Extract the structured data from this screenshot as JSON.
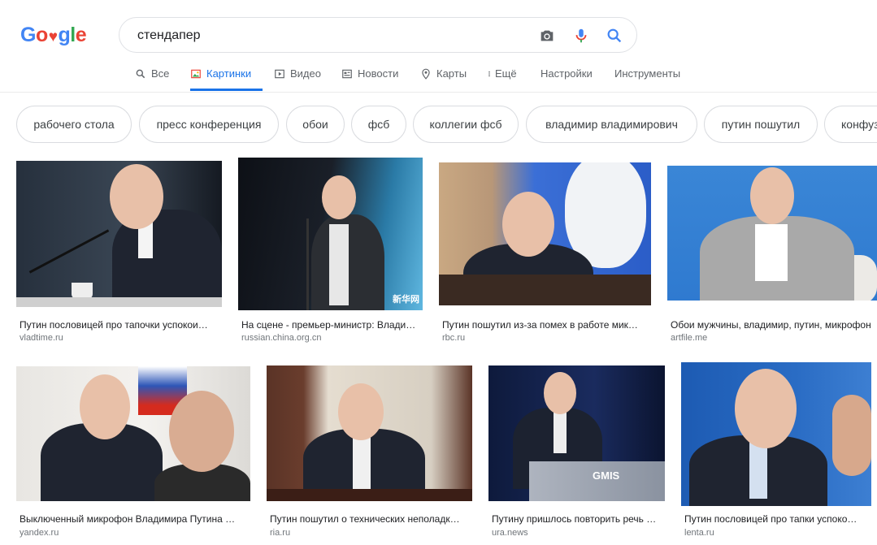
{
  "logo": {
    "letters": [
      "G",
      "o",
      "o",
      "g",
      "l",
      "e"
    ],
    "colors": [
      "#4285f4",
      "#ea4335",
      "#fbbc05",
      "#4285f4",
      "#34a853",
      "#ea4335"
    ]
  },
  "search": {
    "query": "стендапер",
    "icons": [
      "camera-icon",
      "microphone-icon",
      "search-icon"
    ]
  },
  "tabs": [
    {
      "label": "Все",
      "icon": "search-icon"
    },
    {
      "label": "Картинки",
      "icon": "image-icon",
      "active": true
    },
    {
      "label": "Видео",
      "icon": "video-icon"
    },
    {
      "label": "Новости",
      "icon": "news-icon"
    },
    {
      "label": "Карты",
      "icon": "map-pin-icon"
    },
    {
      "label": "Ещё",
      "icon": "more-vertical-icon"
    },
    {
      "label": "Настройки"
    },
    {
      "label": "Инструменты"
    }
  ],
  "chips": [
    "рабочего стола",
    "пресс конференция",
    "обои",
    "фсб",
    "коллегии фсб",
    "владимир владимирович",
    "путин пошутил",
    "конфуз"
  ],
  "results": [
    {
      "caption": "Путин пословицей про тапочки успокои…",
      "source": "vladtime.ru"
    },
    {
      "caption": "На сцене - премьер-министр: Влади…",
      "source": "russian.china.org.cn"
    },
    {
      "caption": "Путин пошутил из-за помех в работе мик…",
      "source": "rbc.ru"
    },
    {
      "caption": "Обои мужчины, владимир, путин, микрофон",
      "source": "artfile.me"
    },
    {
      "caption": "Выключенный микрофон Владимира Путина …",
      "source": "yandex.ru"
    },
    {
      "caption": "Путин пошутил о технических неполадк…",
      "source": "ria.ru"
    },
    {
      "caption": "Путину пришлось повторить речь …",
      "source": "ura.news"
    },
    {
      "caption": "Путин пословицей про тапки успоко…",
      "source": "lenta.ru"
    }
  ],
  "watermark": "新华网",
  "podium_text": "GMIS"
}
